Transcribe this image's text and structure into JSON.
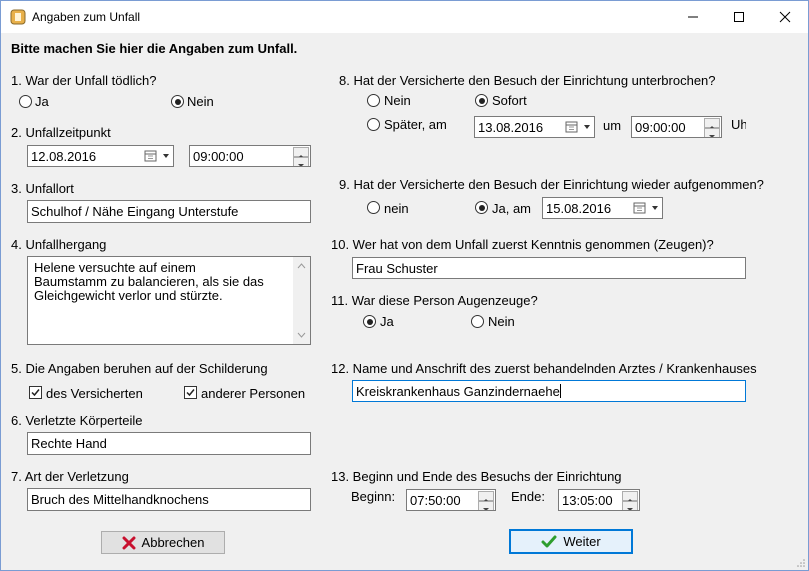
{
  "window": {
    "title": "Angaben zum Unfall"
  },
  "heading": "Bitte machen Sie hier die Angaben zum Unfall.",
  "q1": {
    "label": "1. War der Unfall tödlich?",
    "opt_ja": "Ja",
    "opt_nein": "Nein",
    "selected": "Nein"
  },
  "q2": {
    "label": "2. Unfallzeitpunkt",
    "date": "12.08.2016",
    "time": "09:00:00"
  },
  "q3": {
    "label": "3. Unfallort",
    "value": "Schulhof / Nähe Eingang Unterstufe"
  },
  "q4": {
    "label": "4. Unfallhergang",
    "lines": [
      "Helene versuchte auf einem",
      "Baumstamm zu balancieren, als sie das",
      "Gleichgewicht verlor und stürzte."
    ]
  },
  "q5": {
    "label": "5. Die Angaben beruhen auf der Schilderung",
    "opt1": "des Versicherten",
    "opt2": "anderer Personen",
    "checked": [
      "des Versicherten",
      "anderer Personen"
    ]
  },
  "q6": {
    "label": "6. Verletzte Körperteile",
    "value": "Rechte Hand"
  },
  "q7": {
    "label": "7. Art der Verletzung",
    "value": "Bruch des Mittelhandknochens"
  },
  "q8": {
    "label": "8. Hat der Versicherte den Besuch der  Einrichtung unterbrochen?",
    "opt_nein": "Nein",
    "opt_sofort": "Sofort",
    "opt_spaeter": "Später, am",
    "selected": "Sofort",
    "date": "13.08.2016",
    "um": "um",
    "time": "09:00:00",
    "uhr": "Uhr"
  },
  "q9": {
    "label": "9. Hat der Versicherte den Besuch der  Einrichtung wieder aufgenommen?",
    "opt_nein": "nein",
    "opt_ja": "Ja, am",
    "selected": "Ja, am",
    "date": "15.08.2016"
  },
  "q10": {
    "label": "10. Wer hat von dem Unfall zuerst Kenntnis genommen (Zeugen)?",
    "value": "Frau Schuster"
  },
  "q11": {
    "label": "11. War diese Person Augenzeuge?",
    "opt_ja": "Ja",
    "opt_nein": "Nein",
    "selected": "Ja"
  },
  "q12": {
    "label": "12. Name und Anschrift des zuerst behandelnden Arztes / Krankenhauses",
    "value": "Kreiskrankenhaus Ganzindernaehe"
  },
  "q13": {
    "label": "13. Beginn und Ende des Besuchs der Einrichtung",
    "beginn_label": "Beginn:",
    "beginn": "07:50:00",
    "ende_label": "Ende:",
    "ende": "13:05:00"
  },
  "buttons": {
    "cancel": "Abbrechen",
    "next": "Weiter"
  },
  "icons": {
    "cancel": "red-x-icon",
    "next": "green-check-icon"
  },
  "colors": {
    "accent": "#0078d7",
    "cancel_icon": "#c8102e",
    "next_icon": "#2e9e2e"
  }
}
